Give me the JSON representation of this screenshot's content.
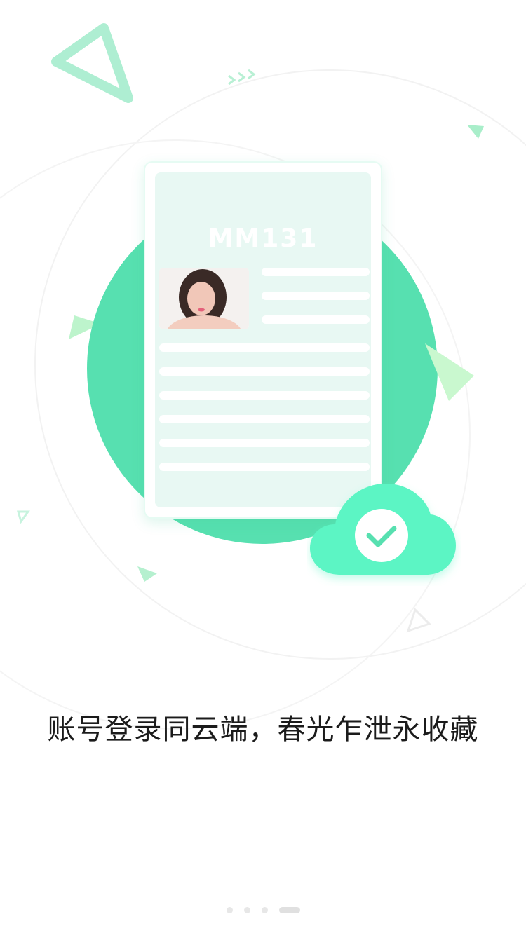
{
  "illustration": {
    "logo_text": "MM131",
    "accent": "#57e0b0",
    "cloud_color": "#5cf5c4"
  },
  "slogan": "账号登录同云端，春光乍泄永收藏",
  "pager": {
    "total": 4,
    "active_index": 3
  }
}
